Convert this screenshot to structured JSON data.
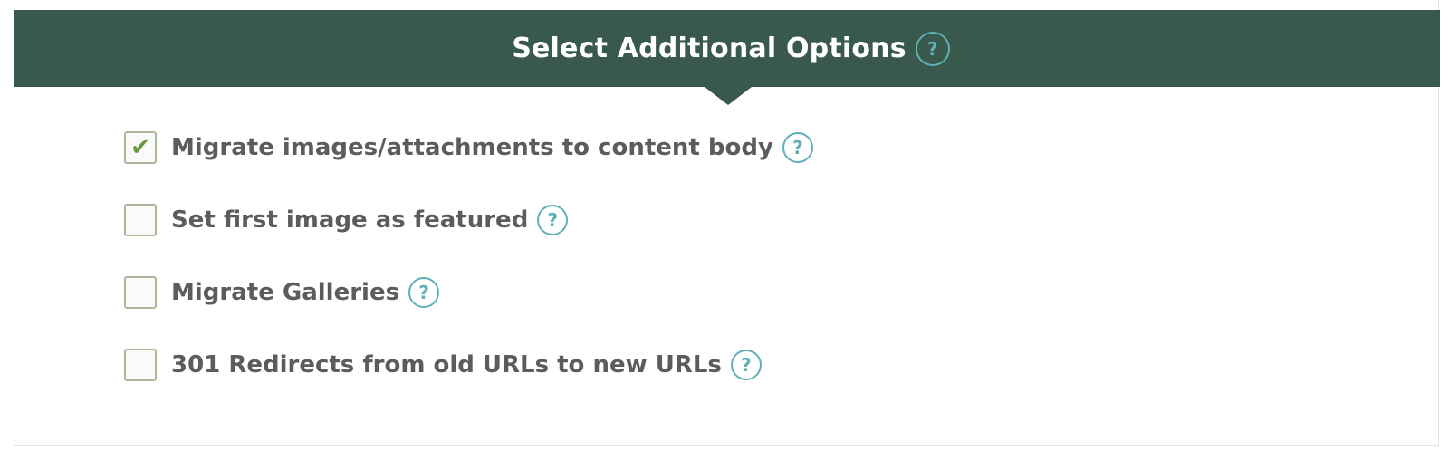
{
  "header": {
    "title": "Select Additional Options",
    "help_symbol": "?"
  },
  "options": [
    {
      "label": "Migrate images/attachments to content body",
      "checked": true,
      "help_symbol": "?"
    },
    {
      "label": "Set first image as featured",
      "checked": false,
      "help_symbol": "?"
    },
    {
      "label": "Migrate Galleries",
      "checked": false,
      "help_symbol": "?"
    },
    {
      "label": "301 Redirects from old URLs to new URLs",
      "checked": false,
      "help_symbol": "?"
    }
  ],
  "icons": {
    "check": "check-icon",
    "help": "help-circle-icon"
  },
  "colors": {
    "header_bg": "#38594b",
    "header_text": "#ffffff",
    "help_accent": "#5fb0b7",
    "label_text": "#5c5c5c",
    "checkbox_border": "#a9b899",
    "checkmark": "#6a9a3c"
  }
}
